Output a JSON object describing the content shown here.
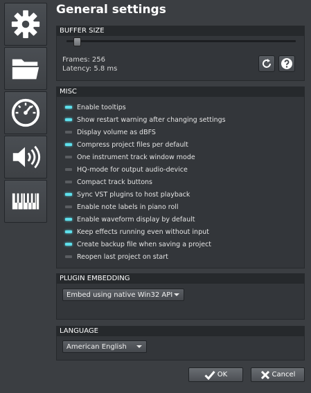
{
  "header": {
    "title": "General settings"
  },
  "sidebar": {
    "items": [
      {
        "name": "general",
        "icon": "gear-icon"
      },
      {
        "name": "paths",
        "icon": "folder-icon"
      },
      {
        "name": "performance",
        "icon": "gauge-icon"
      },
      {
        "name": "audio",
        "icon": "speaker-icon"
      },
      {
        "name": "midi",
        "icon": "keyboard-icon"
      }
    ]
  },
  "buffer": {
    "header": "BUFFER SIZE",
    "frames_label": "Frames: 256",
    "latency_label": "Latency: 5.8 ms",
    "slider_fraction": 0.03
  },
  "misc": {
    "header": "MISC",
    "items": [
      {
        "label": "Enable tooltips",
        "enabled": true
      },
      {
        "label": "Show restart warning after changing settings",
        "enabled": true
      },
      {
        "label": "Display volume as dBFS",
        "enabled": false
      },
      {
        "label": "Compress project files per default",
        "enabled": true
      },
      {
        "label": "One instrument track window mode",
        "enabled": false
      },
      {
        "label": "HQ-mode for output audio-device",
        "enabled": false
      },
      {
        "label": "Compact track buttons",
        "enabled": false
      },
      {
        "label": "Sync VST plugins to host playback",
        "enabled": true
      },
      {
        "label": "Enable note labels in piano roll",
        "enabled": false
      },
      {
        "label": "Enable waveform display by default",
        "enabled": true
      },
      {
        "label": "Keep effects running even without input",
        "enabled": true
      },
      {
        "label": "Create backup file when saving a project",
        "enabled": true
      },
      {
        "label": "Reopen last project on start",
        "enabled": false
      }
    ]
  },
  "plugin_embedding": {
    "header": "PLUGIN EMBEDDING",
    "selected": "Embed using native Win32 API"
  },
  "language": {
    "header": "LANGUAGE",
    "selected": "American English"
  },
  "footer": {
    "ok_label": "OK",
    "cancel_label": "Cancel"
  },
  "colors": {
    "led_on": "#5ee0ec",
    "led_off": "#5a5d61",
    "background": "#3b3e42"
  }
}
